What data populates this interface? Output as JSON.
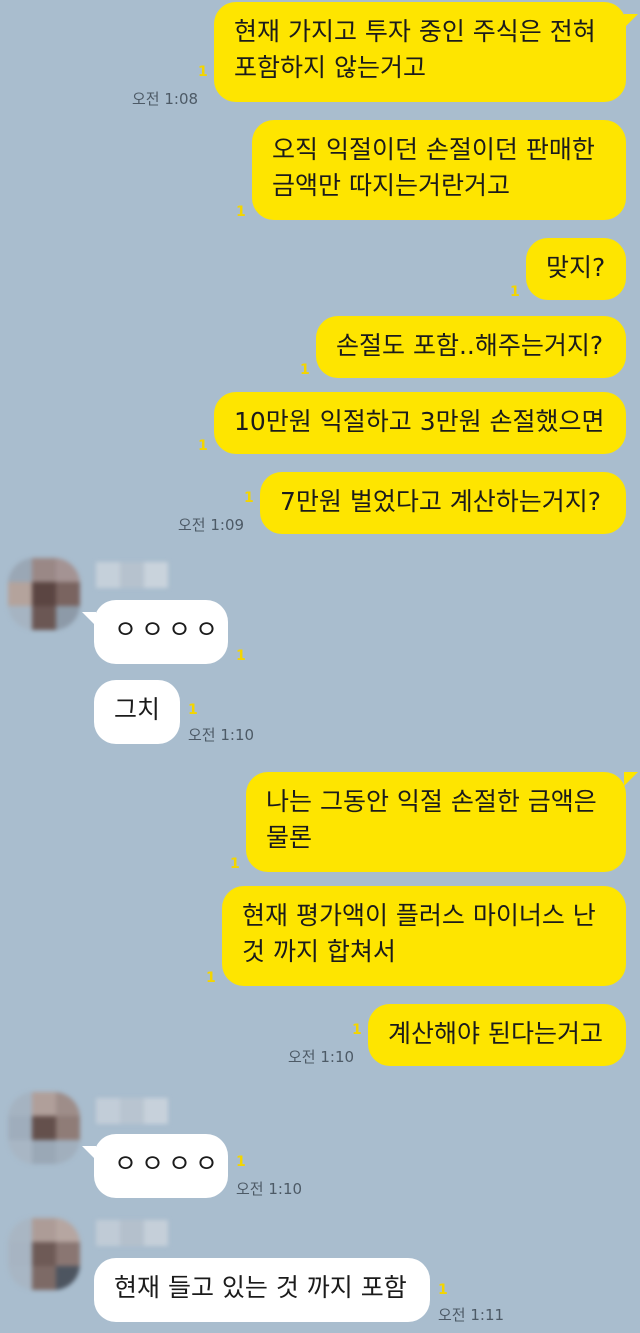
{
  "messages": [
    {
      "sender": "me",
      "lines": [
        "현재 가지고 투자 중인 주식은 전혀",
        "포함하지 않는거고"
      ],
      "unread": "1",
      "time": "오전 1:08"
    },
    {
      "sender": "me",
      "lines": [
        "오직 익절이던 손절이던 판매한",
        "금액만 따지는거란거고"
      ],
      "unread": "1",
      "time": ""
    },
    {
      "sender": "me",
      "lines": [
        "맞지?"
      ],
      "unread": "1",
      "time": ""
    },
    {
      "sender": "me",
      "lines": [
        "손절도 포함..해주는거지?"
      ],
      "unread": "1",
      "time": ""
    },
    {
      "sender": "me",
      "lines": [
        "10만원 익절하고 3만원 손절했으면"
      ],
      "unread": "1",
      "time": ""
    },
    {
      "sender": "me",
      "lines": [
        "7만원 벌었다고 계산하는거지?"
      ],
      "unread": "1",
      "time": "오전 1:09"
    },
    {
      "sender": "other",
      "lines": [
        "ㅇㅇㅇㅇ"
      ],
      "unread": "1",
      "time": ""
    },
    {
      "sender": "other",
      "lines": [
        "그치"
      ],
      "unread": "1",
      "time": "오전 1:10"
    },
    {
      "sender": "me",
      "lines": [
        "나는 그동안 익절 손절한 금액은",
        "물론"
      ],
      "unread": "1",
      "time": ""
    },
    {
      "sender": "me",
      "lines": [
        "현재 평가액이 플러스 마이너스 난",
        "것 까지 합쳐서"
      ],
      "unread": "1",
      "time": ""
    },
    {
      "sender": "me",
      "lines": [
        "계산해야 된다는거고"
      ],
      "unread": "1",
      "time": "오전 1:10"
    },
    {
      "sender": "other",
      "lines": [
        "ㅇㅇㅇㅇ"
      ],
      "unread": "1",
      "time": "오전 1:10"
    },
    {
      "sender": "other",
      "lines": [
        "현재 들고 있는 것 까지 포함"
      ],
      "unread": "1",
      "time": "오전 1:11"
    }
  ],
  "colors": {
    "background": "#a9bdce",
    "my_bubble": "#fee500",
    "other_bubble": "#ffffff",
    "unread_count": "#f3d500",
    "timestamp": "#4d5a66"
  }
}
